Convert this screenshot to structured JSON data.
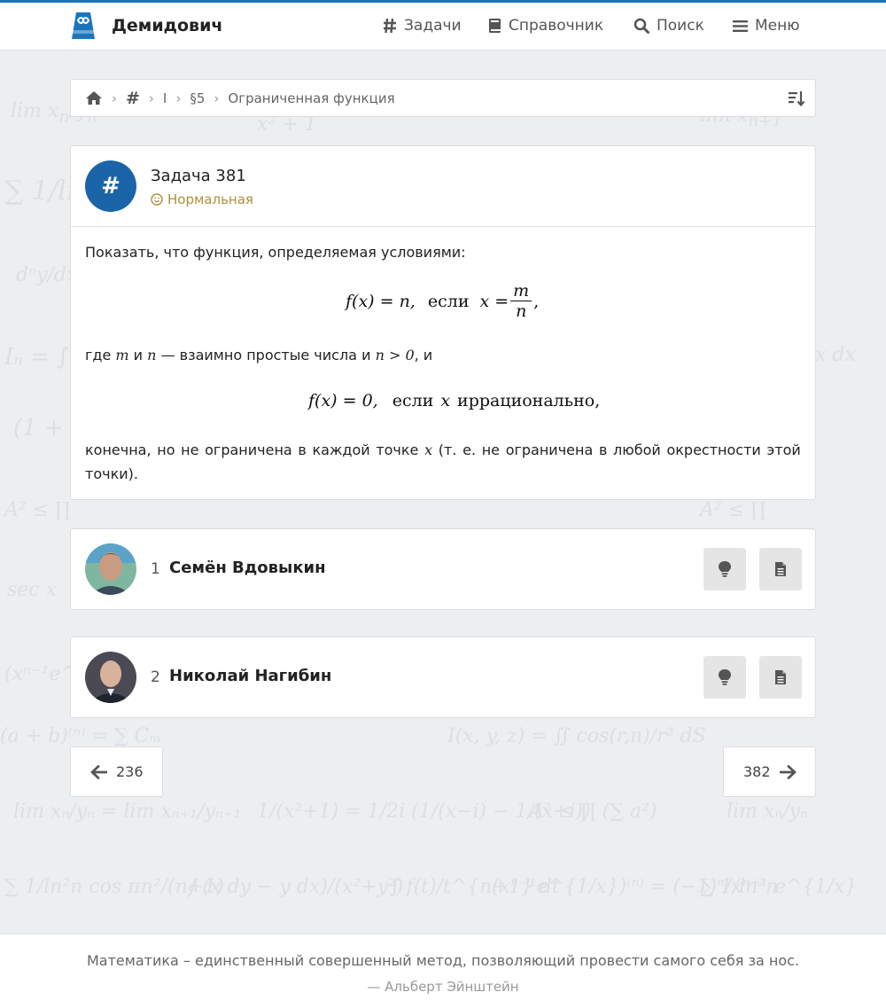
{
  "header": {
    "brand": "Демидович",
    "nav": {
      "tasks": "Задачи",
      "reference": "Справочник",
      "search": "Поиск",
      "menu": "Меню"
    }
  },
  "breadcrumb": {
    "section_hash": "#",
    "part": "I",
    "paragraph": "§5",
    "topic": "Ограниченная функция"
  },
  "task": {
    "badge": "#",
    "title": "Задача 381",
    "difficulty": "Нормальная",
    "text1": "Показать, что функция, определяемая условиями:",
    "f1": {
      "lhs": "f(x) = n,",
      "if_word": "если",
      "var": "x =",
      "num": "m",
      "den": "n",
      "tail": ","
    },
    "text2_a": "где",
    "text2_m": "m",
    "text2_and": "и",
    "text2_n": "n",
    "text2_b": "— взаимно простые числа и",
    "text2_cond": "n > 0",
    "text2_c": ", и",
    "f2": {
      "lhs": "f(x) = 0,",
      "if_word": "если",
      "var": "x",
      "rest": "иррационально,"
    },
    "text3_words": [
      "конечна,",
      "но",
      "не",
      "ограничена",
      "в",
      "каждой",
      "точке"
    ],
    "text3_x": "x",
    "text3_rest": [
      "(т.",
      "е.",
      "не",
      "ограничена",
      "в",
      "любой",
      "окрестности",
      "этой"
    ],
    "text3_line2": "точки)."
  },
  "solutions": [
    {
      "number": "1",
      "name": "Семён Вдовыкин"
    },
    {
      "number": "2",
      "name": "Николай Нагибин"
    }
  ],
  "pager": {
    "prev": "236",
    "next": "382"
  },
  "footer": {
    "quote": "Математика – единственный совершенный метод, позволяющий провести самого себя за нос.",
    "author": "—  Альберт Эйнштейн"
  },
  "colors": {
    "accent": "#1b75bb",
    "badge": "#1b64a8",
    "difficulty": "#b08f3a",
    "background": "#eceef0"
  }
}
